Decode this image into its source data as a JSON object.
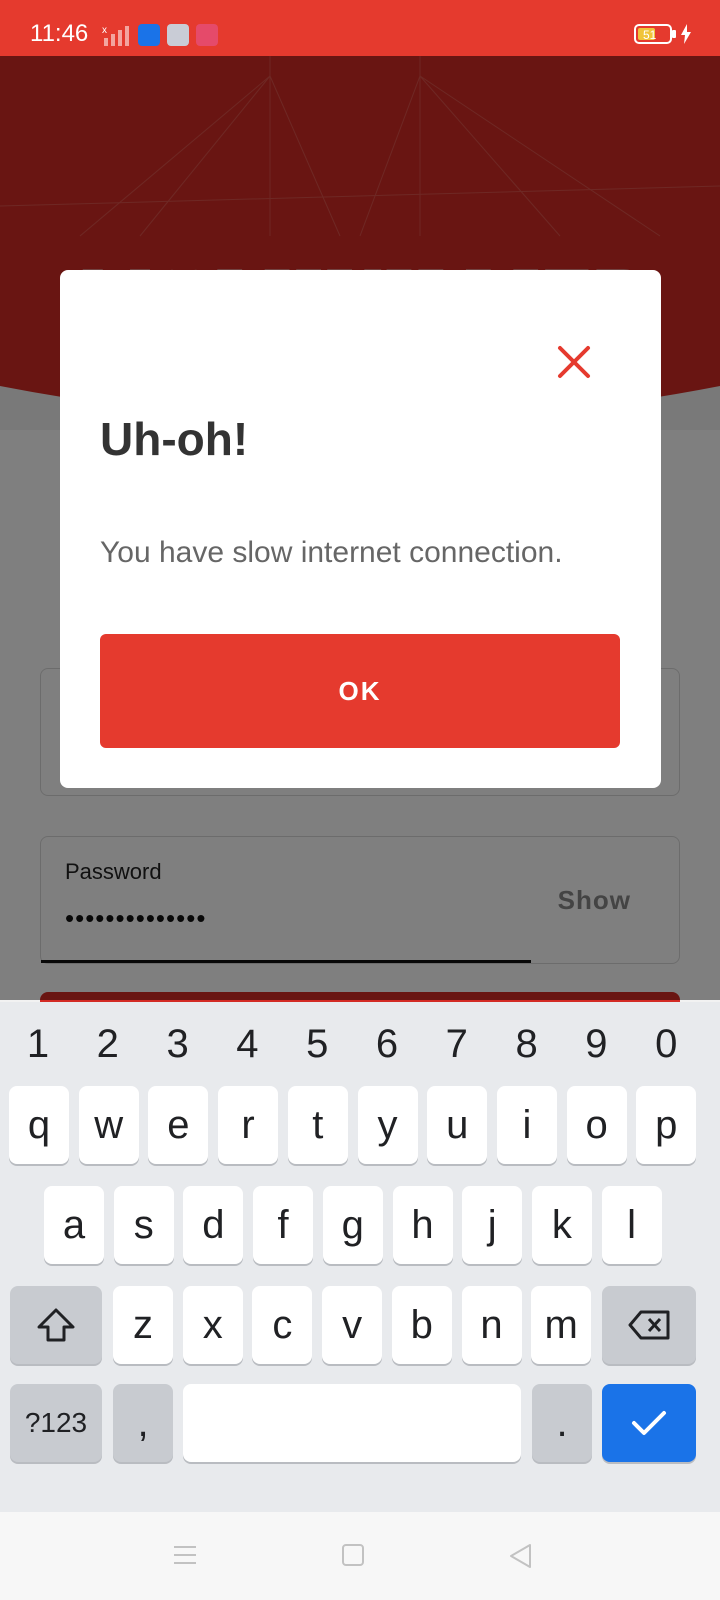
{
  "status_bar": {
    "time": "11:46",
    "battery_level": "51"
  },
  "app": {
    "brand_name": "M♥LHUILLIER",
    "password_label": "Password",
    "password_value": "••••••••••••••",
    "show_label": "Show"
  },
  "dialog": {
    "title": "Uh-oh!",
    "message": "You have slow internet connection.",
    "ok_label": "OK"
  },
  "keyboard": {
    "number_row": [
      "1",
      "2",
      "3",
      "4",
      "5",
      "6",
      "7",
      "8",
      "9",
      "0"
    ],
    "row1": [
      "q",
      "w",
      "e",
      "r",
      "t",
      "y",
      "u",
      "i",
      "o",
      "p"
    ],
    "row2": [
      "a",
      "s",
      "d",
      "f",
      "g",
      "h",
      "j",
      "k",
      "l"
    ],
    "row3": [
      "z",
      "x",
      "c",
      "v",
      "b",
      "n",
      "m"
    ],
    "symbols_label": "?123",
    "comma": ",",
    "period": "."
  },
  "colors": {
    "brand_red": "#e53a2e",
    "keyboard_accent": "#1a73e8"
  }
}
